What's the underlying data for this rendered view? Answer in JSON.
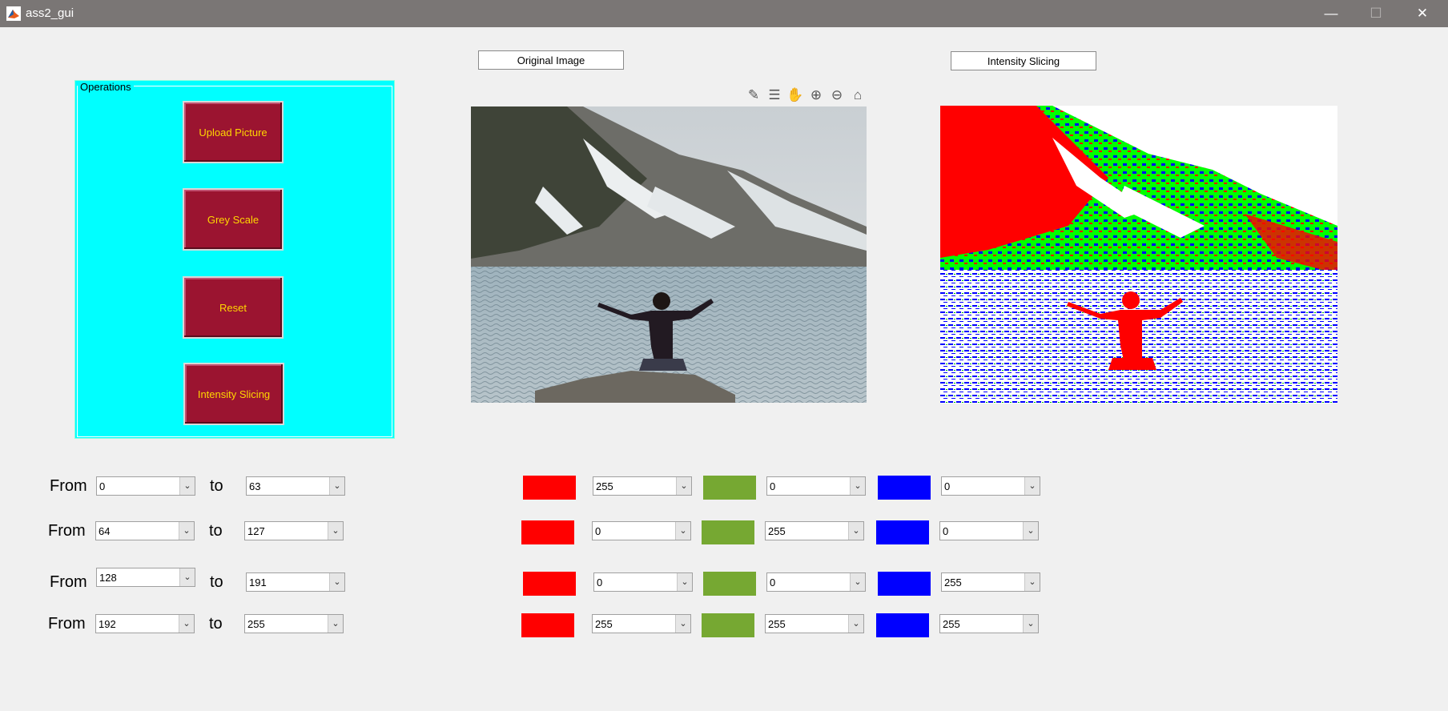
{
  "window": {
    "title": "ass2_gui",
    "controls": {
      "minimize": "—",
      "maximize": "☐",
      "close": "✕"
    }
  },
  "operations": {
    "title": "Operations",
    "buttons": [
      {
        "label": "Upload Picture"
      },
      {
        "label": "Grey Scale"
      },
      {
        "label": "Reset"
      },
      {
        "label": "Intensity Slicing"
      }
    ]
  },
  "images": {
    "original_label": "Original Image",
    "sliced_label": "Intensity Slicing"
  },
  "toolbar": {
    "icons": [
      "brush-icon",
      "data-tip-icon",
      "pan-hand-icon",
      "zoom-in-icon",
      "zoom-out-icon",
      "home-icon"
    ]
  },
  "ranges": {
    "from_label": "From",
    "to_label": "to",
    "rows": [
      {
        "from": "0",
        "to": "63",
        "r": "255",
        "g": "0",
        "b": "0"
      },
      {
        "from": "64",
        "to": "127",
        "r": "0",
        "g": "255",
        "b": "0"
      },
      {
        "from": "128",
        "to": "191",
        "r": "0",
        "g": "0",
        "b": "255"
      },
      {
        "from": "192",
        "to": "255",
        "r": "255",
        "g": "255",
        "b": "255"
      }
    ]
  },
  "colors": {
    "red_swatch": "#ff0000",
    "green_swatch": "#76a832",
    "blue_swatch": "#0000ff",
    "panel": "#00ffff",
    "button_bg": "#9b1430",
    "button_text": "#ffd700"
  }
}
